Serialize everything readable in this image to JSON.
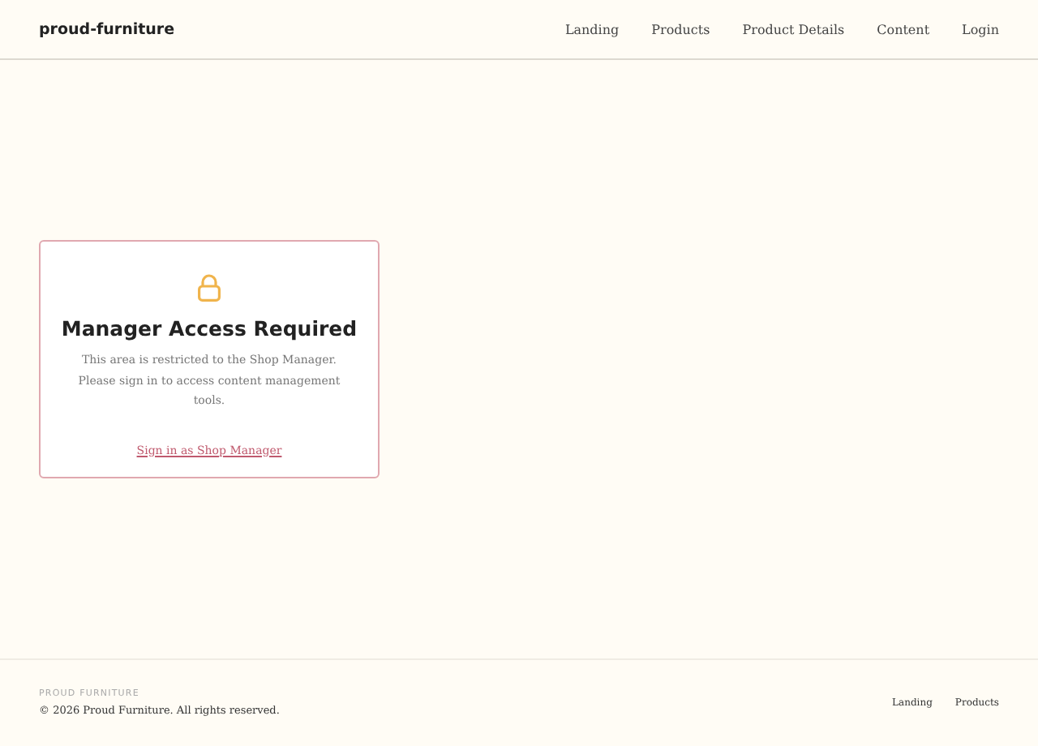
{
  "header": {
    "logo": "proud-furniture",
    "nav": [
      {
        "label": "Landing"
      },
      {
        "label": "Products"
      },
      {
        "label": "Product Details"
      },
      {
        "label": "Content"
      },
      {
        "label": "Login"
      }
    ]
  },
  "card": {
    "title": "Manager Access Required",
    "message": "This area is restricted to the Shop Manager. Please sign in to access content management tools.",
    "link": "Sign in as Shop Manager"
  },
  "footer": {
    "brand": "PROUD FURNITURE",
    "copyright": "© 2026 Proud Furniture. All rights reserved.",
    "links": [
      {
        "label": "Landing"
      },
      {
        "label": "Products"
      }
    ]
  }
}
